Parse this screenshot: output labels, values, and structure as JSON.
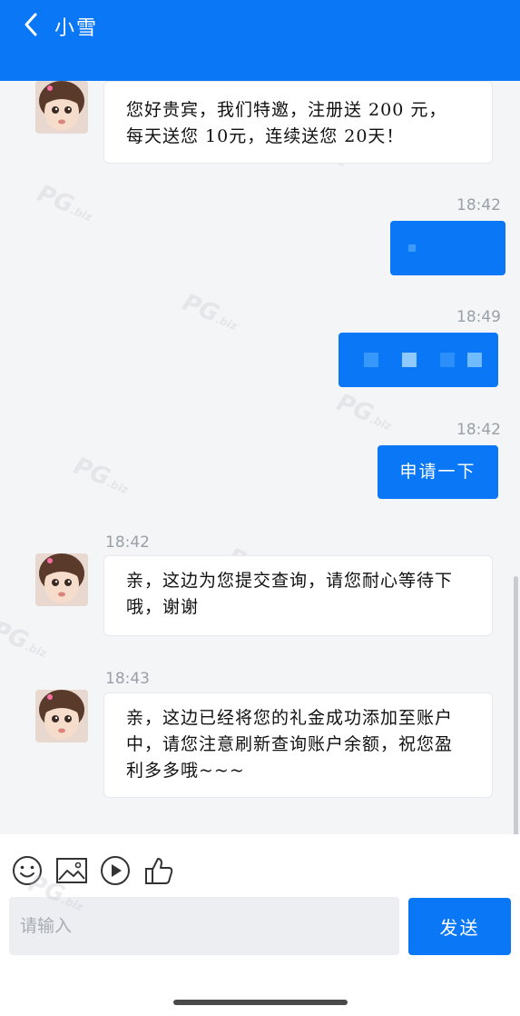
{
  "header": {
    "contact_name": "小雪",
    "accent_color": "#0a78f6",
    "back_icon": "chevron-left-icon"
  },
  "messages": [
    {
      "direction": "incoming",
      "time": "",
      "text_lines": [
        "您好贵宾，我们特邀，注册送 200 元，",
        "每天送您 10元，连续送您 20天！"
      ]
    },
    {
      "direction": "outgoing",
      "time": "18:42",
      "text": "",
      "redacted": true
    },
    {
      "direction": "outgoing",
      "time": "18:49",
      "text": "",
      "redacted": true
    },
    {
      "direction": "outgoing",
      "time": "18:42",
      "text": "申请一下"
    },
    {
      "direction": "incoming",
      "time": "18:42",
      "text_lines": [
        "亲，这边为您提交查询，请您耐心等待下",
        "哦，谢谢"
      ]
    },
    {
      "direction": "incoming",
      "time": "18:43",
      "text_lines": [
        "亲，这边已经将您的礼金成功添加至账户",
        "中，请您注意刷新查询账户余额，祝您盈",
        "利多多哦~~~"
      ]
    }
  ],
  "toolbar": {
    "icons": [
      "emoji-icon",
      "image-icon",
      "video-icon",
      "thumbs-up-icon"
    ]
  },
  "composer": {
    "placeholder": "请输入",
    "value": "",
    "send_label": "发送"
  },
  "watermark": {
    "text": "PG",
    "suffix": ".biz"
  }
}
